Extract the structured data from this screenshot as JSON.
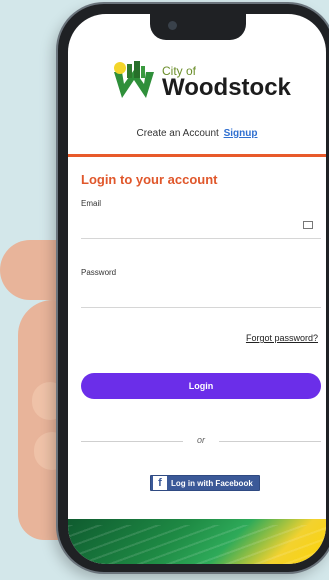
{
  "app": {
    "logo_small": "City of",
    "logo_big": "Woodstock"
  },
  "account": {
    "create_text": "Create an Account",
    "signup_link": "Signup"
  },
  "login": {
    "title": "Login to your account",
    "email_label": "Email",
    "email_value": "",
    "password_label": "Password",
    "password_value": "",
    "forgot_link": "Forgot password?",
    "login_button": "Login",
    "or_text": "or",
    "facebook_button": "Log in with Facebook"
  },
  "colors": {
    "accent": "#6b2ee9",
    "title_orange": "#e0572b",
    "facebook_blue": "#3b5998",
    "signup_blue": "#2f6fd0"
  },
  "icons": {
    "email": "mail-icon",
    "facebook": "facebook-icon",
    "logo": "woodstock-logo-icon"
  }
}
